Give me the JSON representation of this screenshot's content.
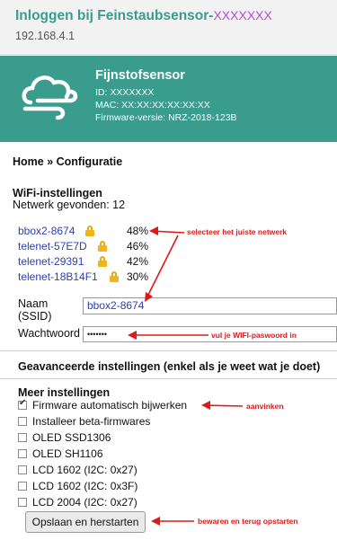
{
  "header": {
    "title": "Inloggen bij Feinstaubsensor-",
    "title_suffix": "XXXXXXX",
    "ip": "192.168.4.1"
  },
  "banner": {
    "name": "Fijnstofsensor",
    "id_line": "ID: XXXXXXX",
    "mac_line": "MAC: XX:XX:XX:XX:XX:XX",
    "firmware_line": "Firmware-versie: NRZ-2018-123B",
    "icon": "cloud-wind-icon"
  },
  "breadcrumb": "Home » Configuratie",
  "wifi": {
    "heading": "WiFi-instellingen",
    "found": "Netwerk gevonden: 12",
    "networks": [
      {
        "ssid": "bbox2-8674",
        "signal": "48%"
      },
      {
        "ssid": "telenet-57E7D",
        "signal": "46%"
      },
      {
        "ssid": "telenet-29391",
        "signal": "42%"
      },
      {
        "ssid": "telenet-18B14F1",
        "signal": "30%"
      }
    ],
    "ssid_label_1": "Naam",
    "ssid_label_2": "(SSID)",
    "ssid_value": "bbox2-8674",
    "password_label": "Wachtwoord",
    "password_value": "•••••••"
  },
  "advanced_heading": "Geavanceerde instellingen (enkel als je weet wat je doet)",
  "more": {
    "heading": "Meer instellingen",
    "options": [
      {
        "label": "Firmware automatisch bijwerken",
        "checked": true
      },
      {
        "label": "Installeer beta-firmwares",
        "checked": false
      },
      {
        "label": "OLED SSD1306",
        "checked": false
      },
      {
        "label": "OLED SH1106",
        "checked": false
      },
      {
        "label": "LCD 1602 (I2C: 0x27)",
        "checked": false
      },
      {
        "label": "LCD 1602 (I2C: 0x3F)",
        "checked": false
      },
      {
        "label": "LCD 2004 (I2C: 0x27)",
        "checked": false
      }
    ]
  },
  "save_button": "Opslaan en herstarten",
  "annotations": {
    "network": "selecteer het juiste netwerk",
    "password": "vul je WIFI-paswoord in",
    "check": "aanvinken",
    "save": "bewaren en terug opstarten",
    "color": "#e01818"
  },
  "colors": {
    "brand": "#3a9c8c",
    "placeholder": "#b74ad6",
    "link": "#2c3fb3",
    "lock": "#f1b41c"
  }
}
